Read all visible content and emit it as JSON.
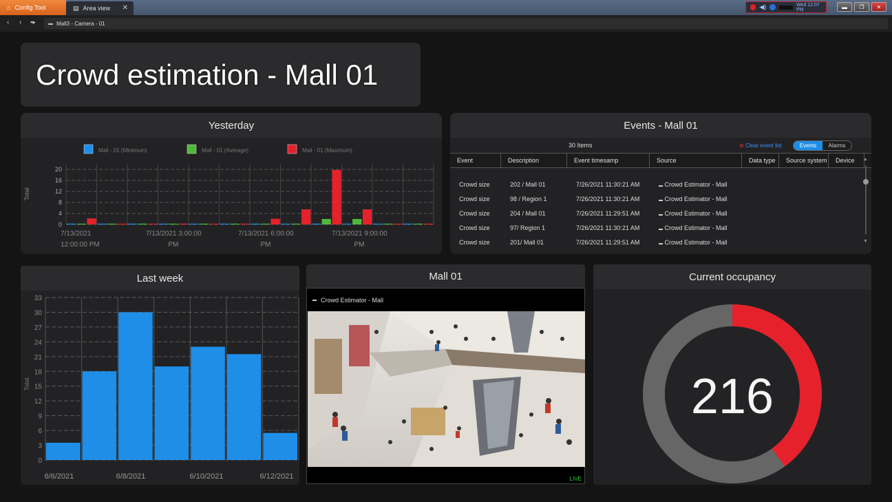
{
  "tabs": [
    {
      "label": "Config Tool",
      "icon": "home-icon"
    },
    {
      "label": "Area view",
      "icon": "area-view-icon"
    }
  ],
  "tray": {
    "time": "Wed 12:07 PM"
  },
  "address": {
    "path": "Mall3 - Camera - 01"
  },
  "dashboard_title": "Crowd estimation - Mall 01",
  "yesterday_panel": {
    "title": "Yesterday",
    "chart_data": {
      "type": "bar",
      "legend": [
        "Mall - 01 (Minimum)",
        "Mall - 01 (Average)",
        "Mall - 01 (Maximum)"
      ],
      "colors": [
        "#1e8ee9",
        "#4fb83a",
        "#e5212b"
      ],
      "ylabel": "Total",
      "ylim": [
        0,
        22
      ],
      "yticks": [
        0,
        4,
        8,
        12,
        16,
        20
      ],
      "xtick_labels": [
        [
          "7/13/2021",
          "12:00:00 PM"
        ],
        [
          "7/13/2021 3:00:00",
          "PM"
        ],
        [
          "7/13/2021 6:00:00",
          "PM"
        ],
        [
          "7/13/2021 9:00:00",
          "PM"
        ]
      ],
      "series": [
        {
          "name": "Mall - 01 (Minimum)",
          "values": [
            0.3,
            0.3,
            0.3,
            0.3,
            0.3,
            0.3,
            0.3,
            0.3,
            0.3,
            0.3,
            0.3,
            0.3
          ]
        },
        {
          "name": "Mall - 01 (Average)",
          "values": [
            0.3,
            0.3,
            0.3,
            0.3,
            0.3,
            0.3,
            0.3,
            0.3,
            2,
            2,
            0.3,
            0.3
          ]
        },
        {
          "name": "Mall - 01 (Maximum)",
          "values": [
            2.2,
            0.3,
            0.3,
            0.3,
            0.3,
            0.3,
            2.1,
            5.5,
            19.8,
            5.5,
            0.3,
            0.3
          ]
        }
      ]
    }
  },
  "events_panel": {
    "title": "Events - Mall 01",
    "count_label": "30 Items",
    "clear_label": "Clear event list",
    "toggle": {
      "events": "Events",
      "alarms": "Alarms"
    },
    "columns": [
      "Event",
      "Description",
      "Event timesamp",
      "Source",
      "Data type",
      "Source system",
      "Device"
    ],
    "rows": [
      {
        "event": "Crowd size",
        "description": "202 / Mall 01",
        "timestamp": "7/26/2021 11:30:21 AM",
        "source": "Crowd Estimator - Mall"
      },
      {
        "event": "Crowd size",
        "description": "98 / Region 1",
        "timestamp": "7/26/2021 11:30:21 AM",
        "source": "Crowd Estimator - Mall"
      },
      {
        "event": "Crowd size",
        "description": "204 / Mall 01",
        "timestamp": "7/26/2021 11:29:51 AM",
        "source": "Crowd Estimator - Mall"
      },
      {
        "event": "Crowd size",
        "description": "97/ Region 1",
        "timestamp": "7/26/2021 11:30:21 AM",
        "source": "Crowd Estimator - Mall"
      },
      {
        "event": "Crowd size",
        "description": "201/ Mall 01",
        "timestamp": "7/26/2021 11:29:51 AM",
        "source": "Crowd Estimator - Mall"
      }
    ]
  },
  "lastweek_panel": {
    "title": "Last week",
    "chart_data": {
      "type": "bar",
      "ylabel": "Total",
      "ylim": [
        0,
        33
      ],
      "yticks": [
        0,
        3,
        6,
        9,
        12,
        15,
        18,
        21,
        24,
        27,
        30,
        33
      ],
      "xtick_labels": [
        "6/6/2021",
        "6/8/2021",
        "6/10/2021",
        "6/12/2021"
      ],
      "values": [
        3.5,
        18,
        30,
        19,
        23,
        21.5,
        5.5
      ],
      "color": "#1e8ee9"
    }
  },
  "camera_panel": {
    "title": "Mall 01",
    "stream_label": "Crowd Estimator - Mall",
    "live_label": "LIVE"
  },
  "occupancy_panel": {
    "title": "Current occupancy",
    "value": "216",
    "fraction": 0.4,
    "colors": {
      "filled": "#e5212b",
      "empty": "#666666"
    }
  }
}
